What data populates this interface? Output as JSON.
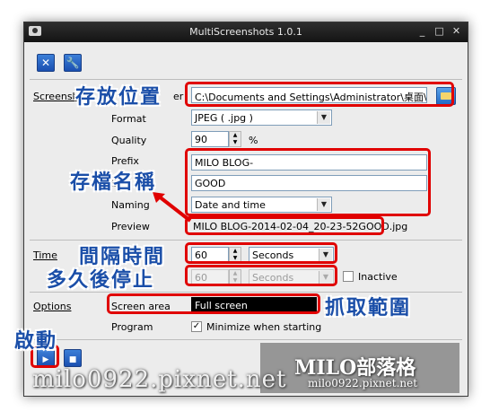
{
  "window": {
    "title": "MultiScreenshots 1.0.1",
    "controls": {
      "minimize": "_",
      "maximize": "□",
      "close": "✕"
    }
  },
  "toolbar": {
    "close_icon": "close-icon",
    "settings_icon": "wrench-icon"
  },
  "form": {
    "screenshot_folder_label_visible": "Screensho",
    "screenshot_folder_label_tail": "er",
    "folder_path": "C:\\Documents and Settings\\Administrator\\桌面\\MILO",
    "format_label": "Format",
    "format_value": "JPEG ( .jpg )",
    "quality_label": "Quality",
    "quality_value": "90",
    "quality_unit": "%",
    "prefix_label": "Prefix",
    "prefix_value": "MILO BLOG-",
    "suffix_label_visible": "Suff",
    "suffix_value": "GOOD",
    "naming_label": "Naming",
    "naming_value": "Date and time",
    "preview_label": "Preview",
    "preview_value": "MILO BLOG-2014-02-04_20-23-52GOOD.jpg",
    "time_label": "Time",
    "time_value": "60",
    "time_unit": "Seconds",
    "stop_value": "60",
    "stop_unit": "Seconds",
    "inactive_label": "Inactive",
    "options_label": "Options",
    "screen_area_label": "Screen area",
    "screen_area_value": "Full screen",
    "program_label": "Program",
    "minimize_label": "Minimize when starting",
    "minimize_checked": "✓"
  },
  "annotations": {
    "save_location": "存放位置",
    "naming": "存檔名稱",
    "interval": "間隔時間",
    "stop_after": "多久後停止",
    "capture_range": "抓取範圍",
    "start": "啟動"
  },
  "watermark": {
    "brand": "MILO部落格",
    "brand_url": "milo0922.pixnet.net",
    "big_url": "milo0922.pixnet.net"
  },
  "colors": {
    "annotation_red": "#e00000",
    "annotation_blue": "#1a4ea8",
    "accent": "#1a4fb0"
  }
}
